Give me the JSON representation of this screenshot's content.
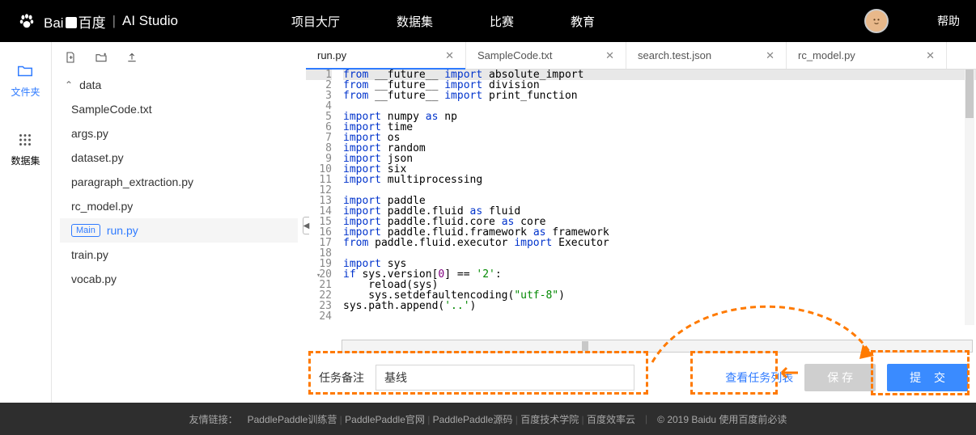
{
  "header": {
    "logo_text": "Bai",
    "logo_suffix": "百度",
    "product": "AI Studio",
    "nav": [
      "项目大厅",
      "数据集",
      "比赛",
      "教育"
    ],
    "help": "帮助"
  },
  "iconbar": {
    "items": [
      {
        "label": "文件夹",
        "active": true
      },
      {
        "label": "数据集",
        "active": false
      }
    ]
  },
  "file_tree": {
    "root": "data",
    "files": [
      "SampleCode.txt",
      "args.py",
      "dataset.py",
      "paragraph_extraction.py",
      "rc_model.py",
      "run.py",
      "train.py",
      "vocab.py"
    ],
    "selected": "run.py",
    "main_badge": "Main"
  },
  "tabs": [
    {
      "name": "run.py",
      "active": true
    },
    {
      "name": "SampleCode.txt",
      "active": false
    },
    {
      "name": "search.test.json",
      "active": false
    },
    {
      "name": "rc_model.py",
      "active": false
    }
  ],
  "code": {
    "lines": [
      {
        "n": 1,
        "hl": true,
        "t": [
          [
            "kw",
            "from"
          ],
          [
            "id",
            " __future__ "
          ],
          [
            "kw",
            "import"
          ],
          [
            "id",
            " absolute_import"
          ]
        ]
      },
      {
        "n": 2,
        "t": [
          [
            "kw",
            "from"
          ],
          [
            "id",
            " __future__ "
          ],
          [
            "kw",
            "import"
          ],
          [
            "id",
            " division"
          ]
        ]
      },
      {
        "n": 3,
        "t": [
          [
            "kw",
            "from"
          ],
          [
            "id",
            " __future__ "
          ],
          [
            "kw",
            "import"
          ],
          [
            "id",
            " print_function"
          ]
        ]
      },
      {
        "n": 4,
        "t": []
      },
      {
        "n": 5,
        "t": [
          [
            "kw",
            "import"
          ],
          [
            "id",
            " numpy "
          ],
          [
            "kw",
            "as"
          ],
          [
            "id",
            " np"
          ]
        ]
      },
      {
        "n": 6,
        "t": [
          [
            "kw",
            "import"
          ],
          [
            "id",
            " time"
          ]
        ]
      },
      {
        "n": 7,
        "t": [
          [
            "kw",
            "import"
          ],
          [
            "id",
            " os"
          ]
        ]
      },
      {
        "n": 8,
        "t": [
          [
            "kw",
            "import"
          ],
          [
            "id",
            " random"
          ]
        ]
      },
      {
        "n": 9,
        "t": [
          [
            "kw",
            "import"
          ],
          [
            "id",
            " json"
          ]
        ]
      },
      {
        "n": 10,
        "t": [
          [
            "kw",
            "import"
          ],
          [
            "id",
            " six"
          ]
        ]
      },
      {
        "n": 11,
        "t": [
          [
            "kw",
            "import"
          ],
          [
            "id",
            " multiprocessing"
          ]
        ]
      },
      {
        "n": 12,
        "t": []
      },
      {
        "n": 13,
        "t": [
          [
            "kw",
            "import"
          ],
          [
            "id",
            " paddle"
          ]
        ]
      },
      {
        "n": 14,
        "t": [
          [
            "kw",
            "import"
          ],
          [
            "id",
            " paddle.fluid "
          ],
          [
            "kw",
            "as"
          ],
          [
            "id",
            " fluid"
          ]
        ]
      },
      {
        "n": 15,
        "t": [
          [
            "kw",
            "import"
          ],
          [
            "id",
            " paddle.fluid.core "
          ],
          [
            "kw",
            "as"
          ],
          [
            "id",
            " core"
          ]
        ]
      },
      {
        "n": 16,
        "t": [
          [
            "kw",
            "import"
          ],
          [
            "id",
            " paddle.fluid.framework "
          ],
          [
            "kw",
            "as"
          ],
          [
            "id",
            " framework"
          ]
        ]
      },
      {
        "n": 17,
        "t": [
          [
            "kw",
            "from"
          ],
          [
            "id",
            " paddle.fluid.executor "
          ],
          [
            "kw",
            "import"
          ],
          [
            "id",
            " Executor"
          ]
        ]
      },
      {
        "n": 18,
        "t": []
      },
      {
        "n": 19,
        "t": [
          [
            "kw",
            "import"
          ],
          [
            "id",
            " sys"
          ]
        ]
      },
      {
        "n": 20,
        "fold": true,
        "t": [
          [
            "kw",
            "if"
          ],
          [
            "id",
            " sys.version["
          ],
          [
            "num",
            "0"
          ],
          [
            "id",
            "] == "
          ],
          [
            "str",
            "'2'"
          ],
          [
            "id",
            ":"
          ]
        ]
      },
      {
        "n": 21,
        "t": [
          [
            "id",
            "    reload(sys)"
          ]
        ]
      },
      {
        "n": 22,
        "t": [
          [
            "id",
            "    sys.setdefaultencoding("
          ],
          [
            "str",
            "\"utf-8\""
          ],
          [
            "id",
            ")"
          ]
        ]
      },
      {
        "n": 23,
        "t": [
          [
            "id",
            "sys.path.append("
          ],
          [
            "str",
            "'..'"
          ],
          [
            "id",
            ")"
          ]
        ]
      },
      {
        "n": 24,
        "t": []
      }
    ]
  },
  "bottom": {
    "label": "任务备注",
    "input_value": "基线",
    "view_link": "查看任务列表",
    "save": "保 存",
    "submit": "提 交"
  },
  "footer": {
    "prefix": "友情链接：",
    "links": [
      "PaddlePaddle训练营",
      "PaddlePaddle官网",
      "PaddlePaddle源码",
      "百度技术学院",
      "百度效率云"
    ],
    "copyright": "© 2019 Baidu 使用百度前必读"
  }
}
